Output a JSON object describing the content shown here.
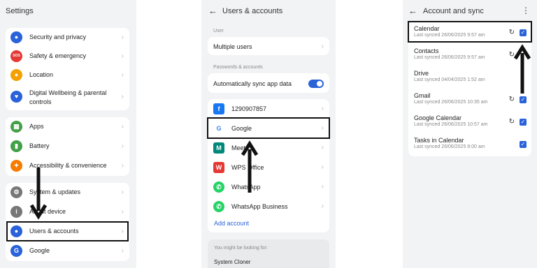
{
  "settings": {
    "title": "Settings",
    "group1": [
      {
        "label": "Security and privacy",
        "icon": "shield-icon",
        "color": "#2962d9"
      },
      {
        "label": "Safety & emergency",
        "icon": "sos-icon",
        "color": "#e53935",
        "glyph": "SOS"
      },
      {
        "label": "Location",
        "icon": "location-pin-icon",
        "color": "#f5a000"
      },
      {
        "label": "Digital Wellbeing & parental controls",
        "icon": "wellbeing-icon",
        "color": "#2962d9"
      }
    ],
    "group2": [
      {
        "label": "Apps",
        "icon": "apps-icon",
        "color": "#43a047"
      },
      {
        "label": "Battery",
        "icon": "battery-icon",
        "color": "#43a047"
      },
      {
        "label": "Accessibility & convenience",
        "icon": "accessibility-icon",
        "color": "#f57c00"
      }
    ],
    "group3": [
      {
        "label": "System & updates",
        "icon": "system-icon",
        "color": "#777"
      },
      {
        "label": "About device",
        "icon": "about-icon",
        "color": "#777"
      },
      {
        "label": "Users & accounts",
        "icon": "users-icon",
        "color": "#2962d9"
      },
      {
        "label": "Google",
        "icon": "google-icon",
        "color": "#2962d9",
        "glyph": "G"
      }
    ]
  },
  "users": {
    "title": "Users & accounts",
    "section_user": "User",
    "multiple_users": "Multiple users",
    "section_passwords": "Passwords & accounts",
    "auto_sync": "Automatically sync app data",
    "accounts": [
      {
        "label": "1290907857",
        "icon": "facebook-icon",
        "color": "#1877f2",
        "glyph": "f"
      },
      {
        "label": "Google",
        "icon": "google-icon",
        "color": "#ffffff",
        "glyph": "G"
      },
      {
        "label": "Meet",
        "icon": "meet-icon",
        "color": "#00897b",
        "glyph": "M"
      },
      {
        "label": "WPS Office",
        "icon": "wps-office-icon",
        "color": "#e53935",
        "glyph": "W"
      },
      {
        "label": "WhatsApp",
        "icon": "whatsapp-icon",
        "color": "#25d366",
        "glyph": "✆"
      },
      {
        "label": "WhatsApp Business",
        "icon": "whatsapp-business-icon",
        "color": "#25d366",
        "glyph": "✆"
      }
    ],
    "add_account": "Add account",
    "looking_for": "You might be looking for:",
    "system_cloner": "System Cloner"
  },
  "sync": {
    "title": "Account and sync",
    "items": [
      {
        "name": "Calendar",
        "sub": "Last synced 26/06/2025 9:57 am",
        "sync_icon": true,
        "checked": true
      },
      {
        "name": "Contacts",
        "sub": "Last synced 26/06/2025 9:57 am",
        "sync_icon": true,
        "checked": false
      },
      {
        "name": "Drive",
        "sub": "Last synced 04/04/2025 1:52 am",
        "sync_icon": false,
        "checked": false
      },
      {
        "name": "Gmail",
        "sub": "Last synced 26/06/2025 10:35 am",
        "sync_icon": true,
        "checked": true
      },
      {
        "name": "Google Calendar",
        "sub": "Last synced 26/06/2025 10:57 am",
        "sync_icon": true,
        "checked": true
      },
      {
        "name": "Tasks in Calendar",
        "sub": "Last synced 26/06/2025 8:00 am",
        "sync_icon": false,
        "checked": true
      }
    ]
  },
  "colors": {
    "accent": "#2962d9",
    "panel_bg": "#f2f3f5",
    "highlight": "#111111"
  },
  "glyphs": {
    "back": "←",
    "chevron": "›",
    "more": "⋮",
    "sync": "↻",
    "check": "✓"
  }
}
